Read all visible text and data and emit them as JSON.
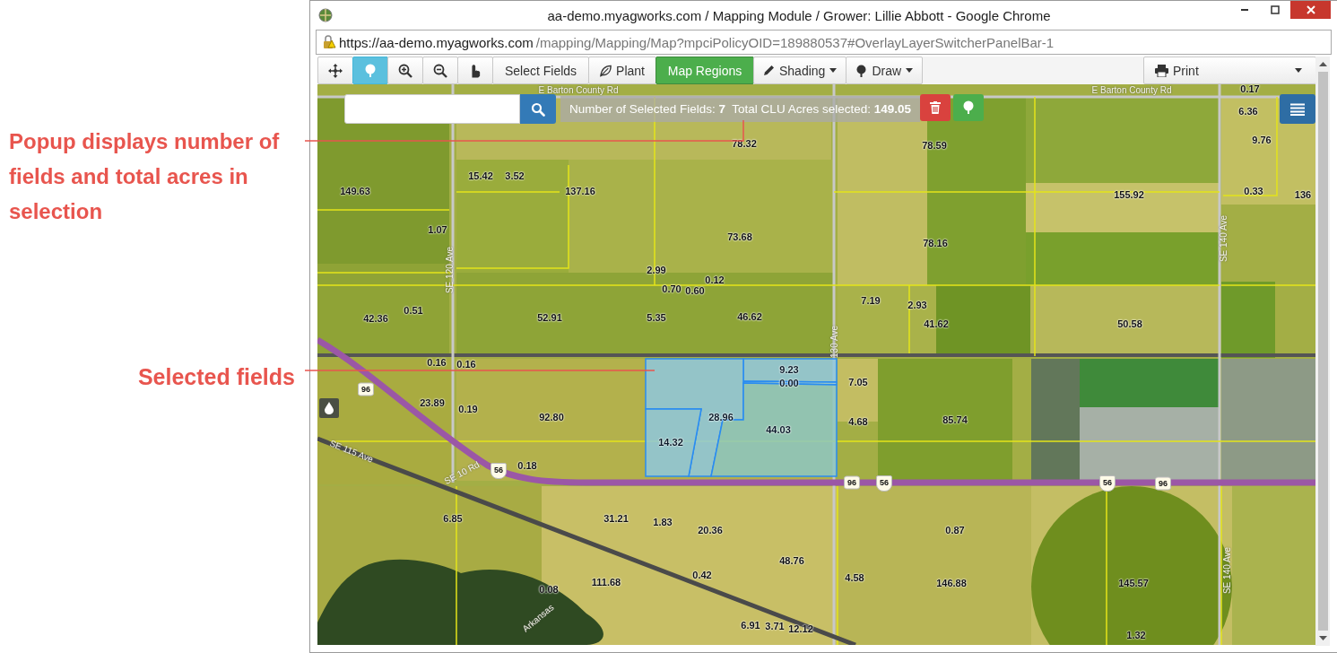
{
  "window": {
    "title": "aa-demo.myagworks.com / Mapping Module / Grower: Lillie Abbott - Google Chrome",
    "url_host": "https://aa-demo.myagworks.com",
    "url_path": "/mapping/Mapping/Map?mpciPolicyOID=189880537#OverlayLayerSwitcherPanelBar-1"
  },
  "annotations": [
    {
      "text": "Popup displays number of fields and total acres in selection"
    },
    {
      "text": "Selected fields"
    }
  ],
  "toolbar": [
    {
      "kind": "icon",
      "selected": false
    },
    {
      "kind": "icon",
      "selected": true
    },
    {
      "kind": "icon",
      "selected": false
    },
    {
      "kind": "icon",
      "selected": false
    },
    {
      "kind": "icon",
      "selected": false
    },
    {
      "kind": "text",
      "label": "Select Fields",
      "selected": false
    },
    {
      "kind": "icon-text",
      "label": "Plant",
      "selected": false
    },
    {
      "kind": "success",
      "label": "Map Regions",
      "selected": false
    },
    {
      "kind": "dropdown",
      "label": "Shading",
      "selected": false
    },
    {
      "kind": "dropdown",
      "label": "Draw",
      "selected": false
    }
  ],
  "print": {
    "label": "Print"
  },
  "selection_popup": {
    "text": "Number of Selected Fields: **7**  Total CLU Acres selected: **149.05**"
  },
  "field_labels": [
    {
      "text": "78.32",
      "selected": false
    },
    {
      "text": "78.59",
      "selected": false
    },
    {
      "text": "0.17",
      "selected": false
    },
    {
      "text": "6.36",
      "selected": false
    },
    {
      "text": "9.76",
      "selected": false
    },
    {
      "text": "149.63",
      "selected": false
    },
    {
      "text": "15.42",
      "selected": false
    },
    {
      "text": "3.52",
      "selected": false
    },
    {
      "text": "137.16",
      "selected": false
    },
    {
      "text": "155.92",
      "selected": false
    },
    {
      "text": "0.33",
      "selected": false
    },
    {
      "text": "136",
      "selected": false
    },
    {
      "text": "1.07",
      "selected": false
    },
    {
      "text": "73.68",
      "selected": false
    },
    {
      "text": "78.16",
      "selected": false
    },
    {
      "text": "2.99",
      "selected": false
    },
    {
      "text": "0.70",
      "selected": false
    },
    {
      "text": "0.60",
      "selected": false
    },
    {
      "text": "0.12",
      "selected": false
    },
    {
      "text": "7.19",
      "selected": false
    },
    {
      "text": "2.93",
      "selected": false
    },
    {
      "text": "0.51",
      "selected": false
    },
    {
      "text": "42.36",
      "selected": false
    },
    {
      "text": "52.91",
      "selected": false
    },
    {
      "text": "5.35",
      "selected": false
    },
    {
      "text": "46.62",
      "selected": false
    },
    {
      "text": "41.62",
      "selected": false
    },
    {
      "text": "50.58",
      "selected": false
    },
    {
      "text": "0.16",
      "selected": false
    },
    {
      "text": "0.16",
      "selected": false
    },
    {
      "text": "9.23",
      "selected": true
    },
    {
      "text": "0.00",
      "selected": true
    },
    {
      "text": "7.05",
      "selected": false
    },
    {
      "text": "23.89",
      "selected": false
    },
    {
      "text": "0.19",
      "selected": false
    },
    {
      "text": "92.80",
      "selected": false
    },
    {
      "text": "28.96",
      "selected": true
    },
    {
      "text": "4.68",
      "selected": false
    },
    {
      "text": "85.74",
      "selected": false
    },
    {
      "text": "44.03",
      "selected": true
    },
    {
      "text": "14.32",
      "selected": true
    },
    {
      "text": "0.18",
      "selected": false
    },
    {
      "text": "6.85",
      "selected": false
    },
    {
      "text": "31.21",
      "selected": false
    },
    {
      "text": "1.83",
      "selected": false
    },
    {
      "text": "20.36",
      "selected": false
    },
    {
      "text": "0.87",
      "selected": false
    },
    {
      "text": "48.76",
      "selected": false
    },
    {
      "text": "0.42",
      "selected": false
    },
    {
      "text": "4.58",
      "selected": false
    },
    {
      "text": "111.68",
      "selected": false
    },
    {
      "text": "146.88",
      "selected": false
    },
    {
      "text": "145.57",
      "selected": false
    },
    {
      "text": "0.08",
      "selected": false
    },
    {
      "text": "6.91",
      "selected": false
    },
    {
      "text": "3.71",
      "selected": false
    },
    {
      "text": "12.12",
      "selected": false
    },
    {
      "text": "1.32",
      "selected": false
    }
  ],
  "road_labels": [
    {
      "text": "E Barton County Rd"
    },
    {
      "text": "E Barton County Rd"
    },
    {
      "text": "SE 120 Ave"
    },
    {
      "text": "130 Ave"
    },
    {
      "text": "SE 140 Ave"
    },
    {
      "text": "SE 140 Ave"
    },
    {
      "text": "SE 115 Ave"
    },
    {
      "text": "SE 10 Rd"
    },
    {
      "text": "Arkansas"
    }
  ],
  "highway_shields": [
    {
      "text": "96",
      "kind": "state"
    },
    {
      "text": "56",
      "kind": "us"
    },
    {
      "text": "96",
      "kind": "state"
    },
    {
      "text": "56",
      "kind": "us"
    },
    {
      "text": "56",
      "kind": "us"
    },
    {
      "text": "96",
      "kind": "state"
    }
  ]
}
